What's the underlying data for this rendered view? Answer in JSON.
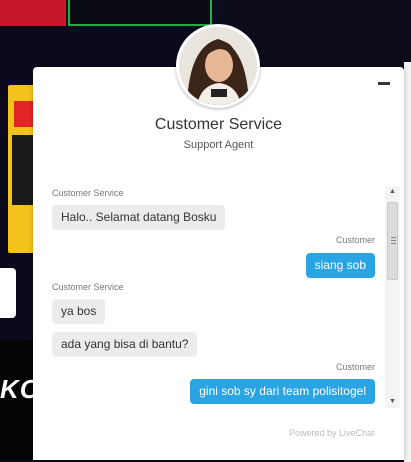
{
  "background": {
    "bottom_text": "KOI"
  },
  "chat": {
    "agent_name": "Customer Service",
    "agent_role": "Support Agent",
    "minimize_icon": "minimize-icon",
    "messages": [
      {
        "sender": "Customer Service",
        "text": "Halo.. Selamat datang Bosku",
        "direction": "in"
      },
      {
        "sender": "Customer",
        "text": "siang sob",
        "direction": "out"
      },
      {
        "sender": "Customer Service",
        "text": "ya bos",
        "direction": "in"
      },
      {
        "sender": "",
        "text": "ada yang bisa di bantu?",
        "direction": "in"
      },
      {
        "sender": "Customer",
        "text": "gini sob sy dari team polisitogel",
        "direction": "out"
      }
    ],
    "powered_by": "Powered by LiveChat"
  },
  "colors": {
    "outgoing_bubble": "#2aa4e3",
    "incoming_bubble": "#ececec"
  }
}
